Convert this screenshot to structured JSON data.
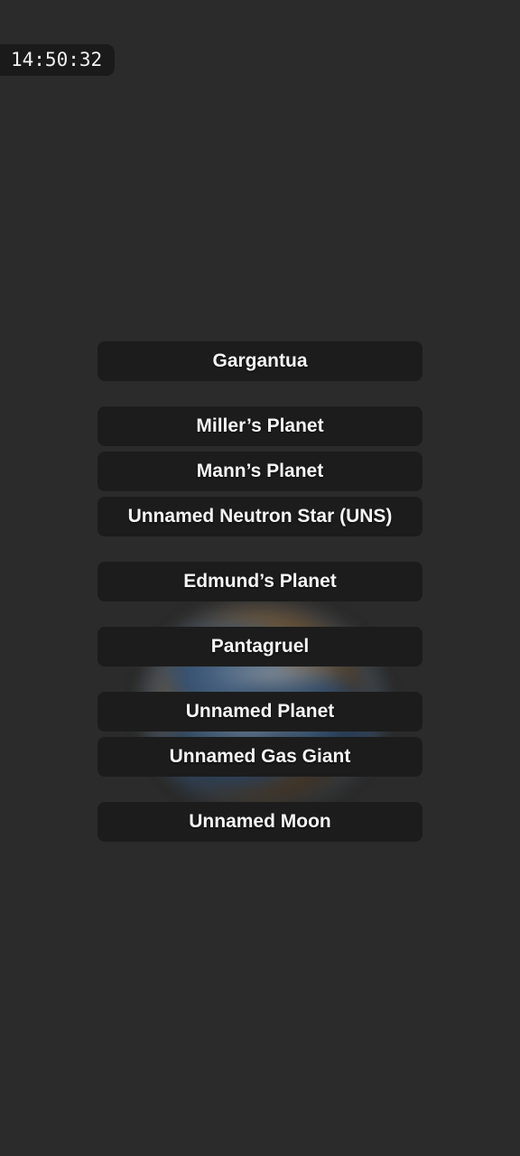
{
  "status_bar": {
    "clock": "14:50:32"
  },
  "background": {
    "page_color": "#2b2b2b",
    "planet": {
      "icon": "planet-sphere-icon",
      "ocean_color": "#3a5f8a",
      "land_color": "#8a6a44",
      "cloud_color": "#d6e0e9",
      "rim_glow_color": "#4e84be",
      "blurred": true
    }
  },
  "menu": {
    "button_color": "#1c1c1c",
    "text_color": "#f5f5f5",
    "groups": [
      {
        "items": [
          {
            "label": "Gargantua"
          }
        ]
      },
      {
        "items": [
          {
            "label": "Miller’s Planet"
          },
          {
            "label": "Mann’s Planet"
          },
          {
            "label": "Unnamed Neutron Star (UNS)"
          }
        ]
      },
      {
        "items": [
          {
            "label": "Edmund’s Planet"
          }
        ]
      },
      {
        "items": [
          {
            "label": "Pantagruel"
          }
        ]
      },
      {
        "items": [
          {
            "label": "Unnamed Planet"
          },
          {
            "label": "Unnamed Gas Giant"
          }
        ]
      },
      {
        "items": [
          {
            "label": "Unnamed Moon"
          }
        ]
      }
    ]
  }
}
